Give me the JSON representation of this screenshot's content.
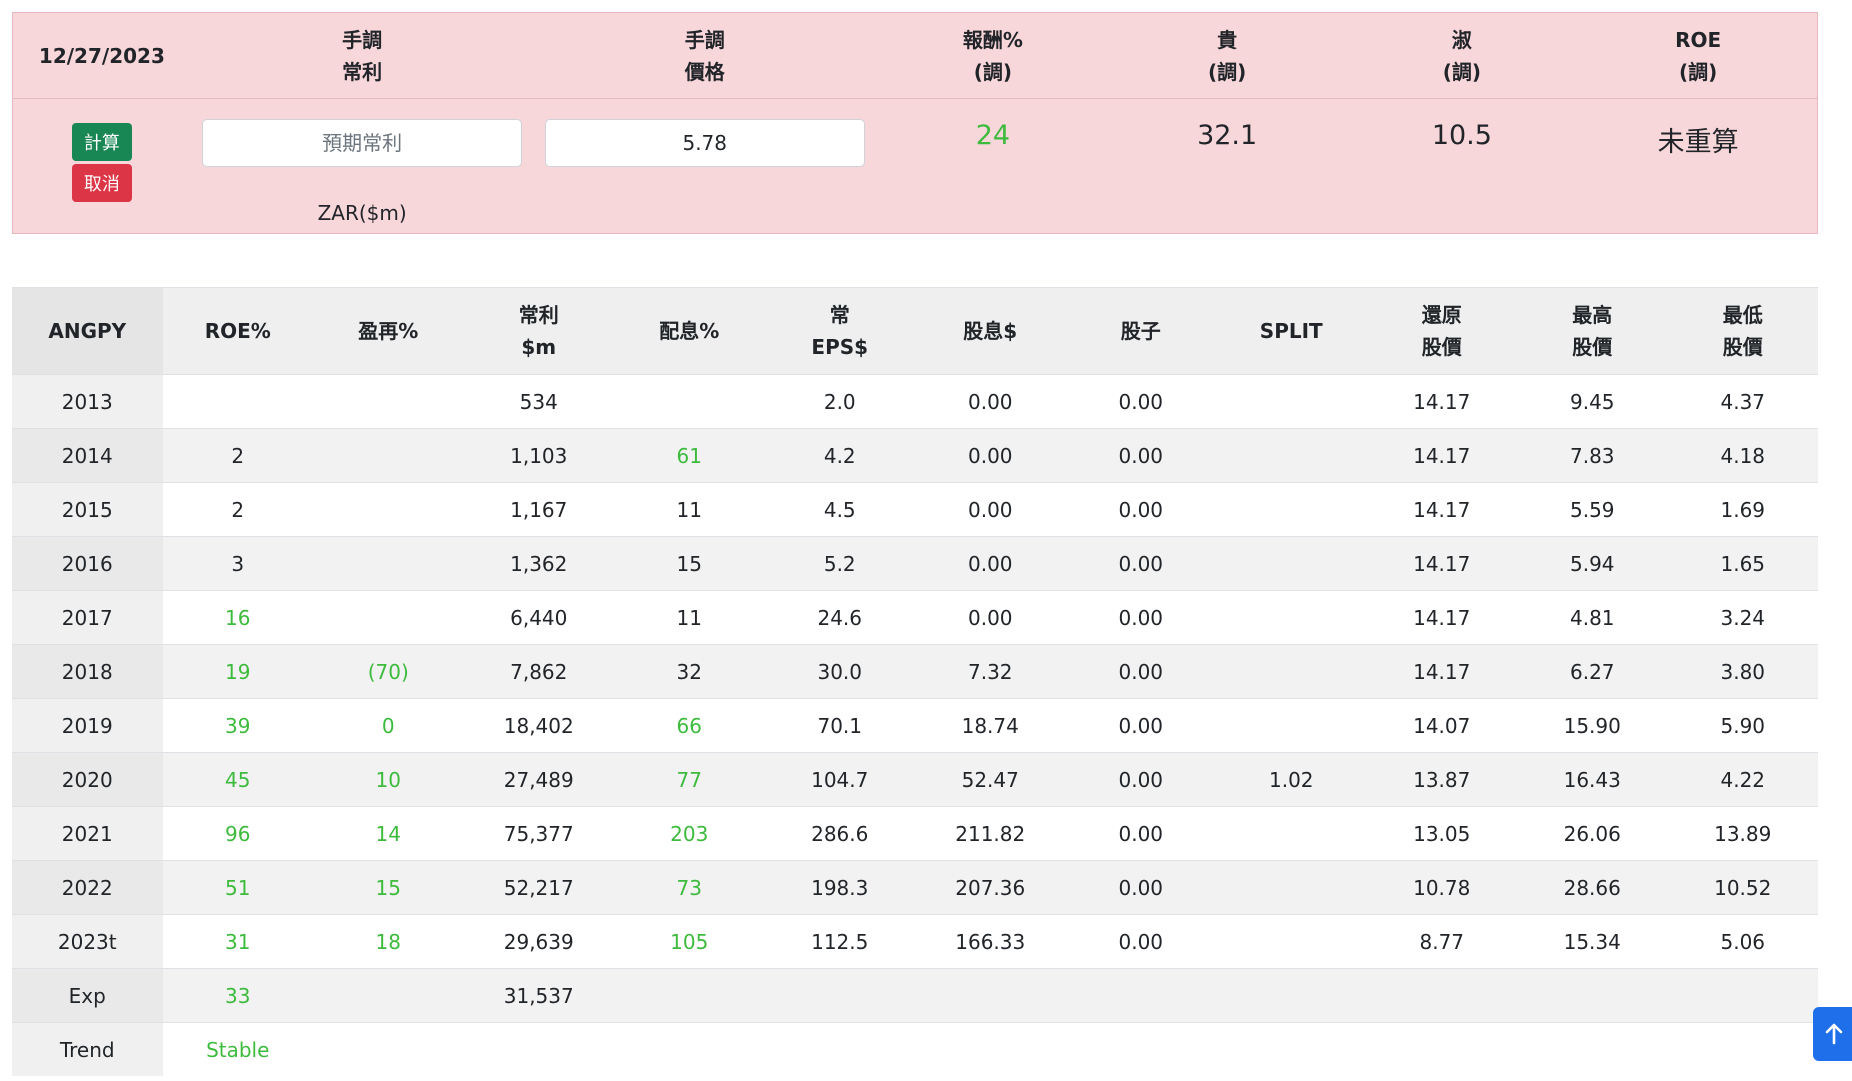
{
  "calc": {
    "date": "12/27/2023",
    "headers": [
      [
        "手調",
        "常利"
      ],
      [
        "手調",
        "價格"
      ],
      [
        "報酬%",
        "(調)"
      ],
      [
        "貴",
        "(調)"
      ],
      [
        "淑",
        "(調)"
      ],
      [
        "ROE",
        "(調)"
      ]
    ],
    "calc_button": "計算",
    "cancel_button": "取消",
    "profit_placeholder": "預期常利",
    "price_value": "5.78",
    "currency_unit": "ZAR($m)",
    "return_pct": "24",
    "expensive": "32.1",
    "cheap": "10.5",
    "roe": "未重算",
    "colors": {
      "positive": "#3dbb3d",
      "calc_button": "#198754",
      "cancel_button": "#dc3545",
      "panel_bg": "#f8d7da"
    }
  },
  "table": {
    "columns": [
      [
        "ANGPY"
      ],
      [
        "ROE%"
      ],
      [
        "盈再%"
      ],
      [
        "常利",
        "$m"
      ],
      [
        "配息%"
      ],
      [
        "常",
        "EPS$"
      ],
      [
        "股息$"
      ],
      [
        "股子"
      ],
      [
        "SPLIT"
      ],
      [
        "還原",
        "股價"
      ],
      [
        "最高",
        "股價"
      ],
      [
        "最低",
        "股價"
      ]
    ],
    "rows": [
      [
        "2013",
        "",
        "",
        "534",
        "",
        "2.0",
        "0.00",
        "0.00",
        "",
        "14.17",
        "9.45",
        "4.37"
      ],
      [
        "2014",
        "2",
        "",
        "1,103",
        "61",
        "4.2",
        "0.00",
        "0.00",
        "",
        "14.17",
        "7.83",
        "4.18"
      ],
      [
        "2015",
        "2",
        "",
        "1,167",
        "11",
        "4.5",
        "0.00",
        "0.00",
        "",
        "14.17",
        "5.59",
        "1.69"
      ],
      [
        "2016",
        "3",
        "",
        "1,362",
        "15",
        "5.2",
        "0.00",
        "0.00",
        "",
        "14.17",
        "5.94",
        "1.65"
      ],
      [
        "2017",
        "16",
        "",
        "6,440",
        "11",
        "24.6",
        "0.00",
        "0.00",
        "",
        "14.17",
        "4.81",
        "3.24"
      ],
      [
        "2018",
        "19",
        "(70)",
        "7,862",
        "32",
        "30.0",
        "7.32",
        "0.00",
        "",
        "14.17",
        "6.27",
        "3.80"
      ],
      [
        "2019",
        "39",
        "0",
        "18,402",
        "66",
        "70.1",
        "18.74",
        "0.00",
        "",
        "14.07",
        "15.90",
        "5.90"
      ],
      [
        "2020",
        "45",
        "10",
        "27,489",
        "77",
        "104.7",
        "52.47",
        "0.00",
        "1.02",
        "13.87",
        "16.43",
        "4.22"
      ],
      [
        "2021",
        "96",
        "14",
        "75,377",
        "203",
        "286.6",
        "211.82",
        "0.00",
        "",
        "13.05",
        "26.06",
        "13.89"
      ],
      [
        "2022",
        "51",
        "15",
        "52,217",
        "73",
        "198.3",
        "207.36",
        "0.00",
        "",
        "10.78",
        "28.66",
        "10.52"
      ],
      [
        "2023t",
        "31",
        "18",
        "29,639",
        "105",
        "112.5",
        "166.33",
        "0.00",
        "",
        "8.77",
        "15.34",
        "5.06"
      ],
      [
        "Exp",
        "33",
        "",
        "31,537",
        "",
        "",
        "",
        "",
        "",
        "",
        "",
        ""
      ],
      [
        "Trend",
        "Stable",
        "",
        "",
        "",
        "",
        "",
        "",
        "",
        "",
        "",
        ""
      ]
    ],
    "highlight": [
      [
        0,
        0,
        0,
        0,
        0,
        0,
        0,
        0,
        0,
        0,
        0,
        0
      ],
      [
        0,
        0,
        0,
        0,
        1,
        0,
        0,
        0,
        0,
        0,
        0,
        0
      ],
      [
        0,
        0,
        0,
        0,
        0,
        0,
        0,
        0,
        0,
        0,
        0,
        0
      ],
      [
        0,
        0,
        0,
        0,
        0,
        0,
        0,
        0,
        0,
        0,
        0,
        0
      ],
      [
        0,
        1,
        0,
        0,
        0,
        0,
        0,
        0,
        0,
        0,
        0,
        0
      ],
      [
        0,
        1,
        1,
        0,
        0,
        0,
        0,
        0,
        0,
        0,
        0,
        0
      ],
      [
        0,
        1,
        1,
        0,
        1,
        0,
        0,
        0,
        0,
        0,
        0,
        0
      ],
      [
        0,
        1,
        1,
        0,
        1,
        0,
        0,
        0,
        0,
        0,
        0,
        0
      ],
      [
        0,
        1,
        1,
        0,
        1,
        0,
        0,
        0,
        0,
        0,
        0,
        0
      ],
      [
        0,
        1,
        1,
        0,
        1,
        0,
        0,
        0,
        0,
        0,
        0,
        0
      ],
      [
        0,
        1,
        1,
        0,
        1,
        0,
        0,
        0,
        0,
        0,
        0,
        0
      ],
      [
        0,
        1,
        0,
        0,
        0,
        0,
        0,
        0,
        0,
        0,
        0,
        0
      ],
      [
        0,
        1,
        0,
        0,
        0,
        0,
        0,
        0,
        0,
        0,
        0,
        0
      ]
    ]
  },
  "scroll_top_icon": "arrow-up-icon"
}
